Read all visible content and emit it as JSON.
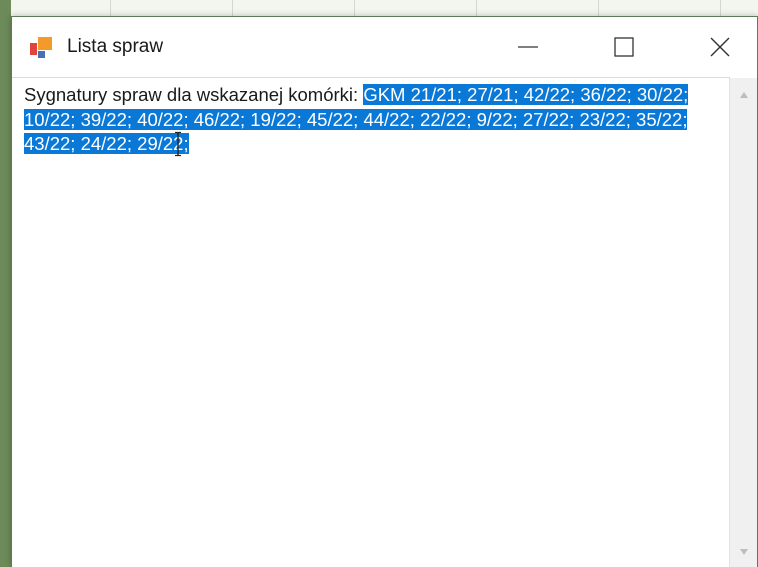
{
  "window": {
    "title": "Lista spraw",
    "controls": {
      "minimize_icon": "minimize-icon",
      "maximize_icon": "maximize-icon",
      "close_icon": "close-icon"
    }
  },
  "content": {
    "label": "Sygnatury spraw dla wskazanej komórki:",
    "selected_text": "GKM 21/21; 27/21; 42/22; 36/22; 30/22; 10/22; 39/22; 40/22; 46/22; 19/22; 45/22; 44/22; 22/22; 9/22; 27/22; 23/22; 35/22; 43/22; 24/22; 29/22;"
  },
  "colors": {
    "selection_bg": "#0a78d7",
    "selection_fg": "#ffffff",
    "icon_red": "#e0443a",
    "icon_orange": "#f39a2b",
    "icon_blue": "#4a6fb0"
  }
}
